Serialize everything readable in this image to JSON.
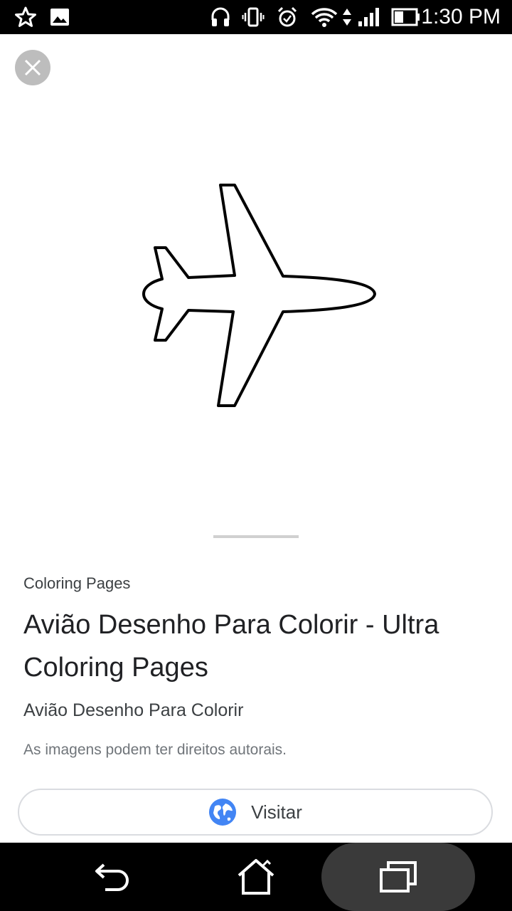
{
  "status_bar": {
    "time": "1:30 PM",
    "icons": [
      "star-icon",
      "image-icon",
      "headphones-icon",
      "vibrate-icon",
      "alarm-icon",
      "wifi-icon",
      "signal-icon",
      "battery-icon"
    ]
  },
  "close": {
    "icon": "close-icon"
  },
  "result": {
    "source": "Coloring Pages",
    "title": "Avião Desenho Para Colorir - Ultra Coloring Pages",
    "subtitle": "Avião Desenho Para Colorir",
    "copyright_notice": "As imagens podem ter direitos autorais."
  },
  "visit_button": {
    "label": "Visitar",
    "icon": "globe-icon"
  },
  "nav_bar": {
    "icons": [
      "back-icon",
      "home-icon",
      "recents-icon"
    ]
  },
  "colors": {
    "globe_blue": "#4285f4",
    "status_bar_bg": "#000000"
  }
}
